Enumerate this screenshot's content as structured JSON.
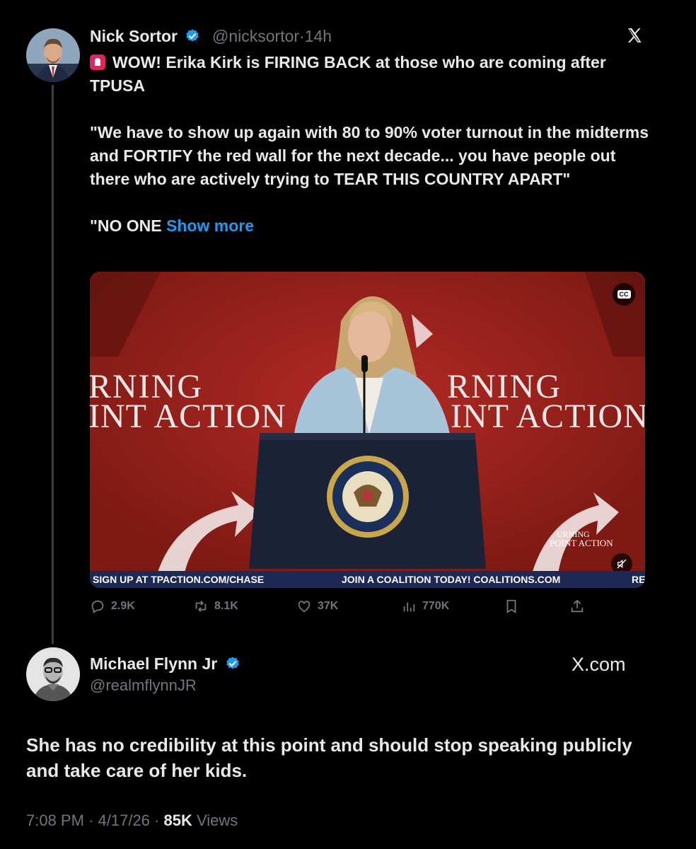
{
  "quoted_tweet": {
    "name": "Nick Sortor",
    "handle": "@nicksortor",
    "separator": "·",
    "time": "14h",
    "lines": [
      "WOW! Erika Kirk is FIRING BACK at those who are coming after TPUSA",
      "\"We have to show up again with 80 to 90% voter turnout in the midterms and FORTIFY the red wall for the next decade... you have people out there who are actively trying to TEAR THIS COUNTRY APART\"",
      "\"NO ONE "
    ],
    "show_more": "Show more",
    "media": {
      "backdrop_text_line1": "RNING",
      "backdrop_text_line2": "INT ACTION",
      "backdrop_text_line1_right": "RNING",
      "backdrop_text_line2_right": "INT ACTION",
      "watermark_line1": "URNING",
      "watermark_line2": "POINT ACTION",
      "ticker_left": "SIGN UP AT TPACTION.COM/CHASE",
      "ticker_center": "JOIN A COALITION TODAY! COALITIONS.COM",
      "ticker_right": "RE",
      "seal_text": "PRESIDENT OF THE UNITED STATES",
      "cc_label": "CC"
    },
    "stats": {
      "replies": "2.9K",
      "reposts": "8.1K",
      "likes": "37K",
      "views": "770K"
    }
  },
  "quoting_tweet": {
    "name": "Michael Flynn Jr",
    "handle": "@realmflynnJR",
    "source": "X.com",
    "text": "She has no credibility at this point and should stop speaking publicly and take care of her kids.",
    "time": "7:08 PM",
    "date": "4/17/26",
    "views_count": "85K",
    "views_label": "Views",
    "separator": "·"
  },
  "colors": {
    "background": "#000000",
    "text": "#e7e9ea",
    "muted": "#71767b",
    "link": "#1d9bf0",
    "verified": "#1d9bf0",
    "stage_red": "#a3211c",
    "ticker": "#1e2a55"
  },
  "icons": [
    "verified-badge-icon",
    "x-logo-icon",
    "siren-emoji-icon",
    "reply-icon",
    "repost-icon",
    "like-icon",
    "views-icon",
    "bookmark-icon",
    "share-icon",
    "closed-captions-icon",
    "mute-icon"
  ]
}
